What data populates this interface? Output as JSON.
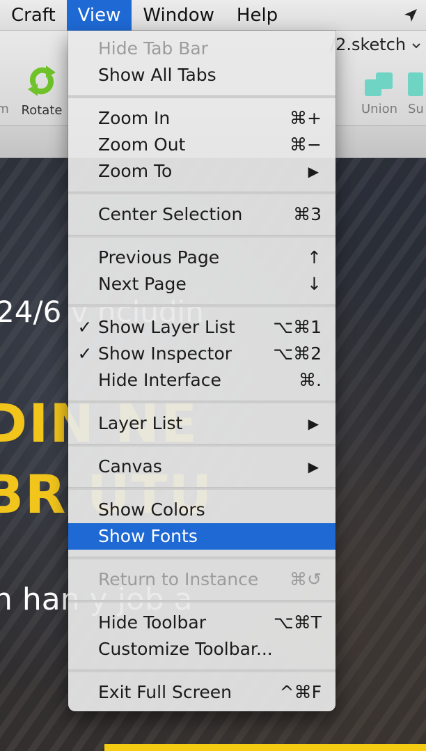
{
  "menubar": {
    "items": [
      "Craft",
      "View",
      "Window",
      "Help"
    ],
    "active_item": "View"
  },
  "toolbar": {
    "document_title": "/2.sketch",
    "left_cut_label": "m",
    "rotate_label": "Rotate",
    "union_label": "Union",
    "subtract_label": "Su"
  },
  "canvas": {
    "hero_subtitle": "24/6 v                           ncludin",
    "hero_heading_line1": "DIN                 NE",
    "hero_heading_line2": "BR                   UTU",
    "hero_description": "n han                    y job a",
    "accent_color": "#f2c51c"
  },
  "view_menu": {
    "items": [
      {
        "label": "Hide Tab Bar",
        "disabled": true
      },
      {
        "label": "Show All Tabs"
      },
      {
        "label": "Zoom In",
        "shortcut": "⌘+"
      },
      {
        "label": "Zoom Out",
        "shortcut": "⌘−"
      },
      {
        "label": "Zoom To",
        "submenu": "▶"
      },
      {
        "label": "Center Selection",
        "shortcut": "⌘3"
      },
      {
        "label": "Previous Page",
        "shortcut": "↑"
      },
      {
        "label": "Next Page",
        "shortcut": "↓"
      },
      {
        "label": "Show Layer List",
        "checked": "✓",
        "shortcut": "⌥⌘1"
      },
      {
        "label": "Show Inspector",
        "checked": "✓",
        "shortcut": "⌥⌘2"
      },
      {
        "label": "Hide Interface",
        "shortcut": "⌘."
      },
      {
        "label": "Layer List",
        "submenu": "▶"
      },
      {
        "label": "Canvas",
        "submenu": "▶"
      },
      {
        "label": "Show Colors"
      },
      {
        "label": "Show Fonts",
        "highlighted": true
      },
      {
        "label": "Return to Instance",
        "disabled": true,
        "shortcut": "⌘↺"
      },
      {
        "label": "Hide Toolbar",
        "shortcut": "⌥⌘T"
      },
      {
        "label": "Customize Toolbar..."
      },
      {
        "label": "Exit Full Screen",
        "shortcut": "^⌘F"
      }
    ],
    "highlight_color": "#1e69d4"
  }
}
